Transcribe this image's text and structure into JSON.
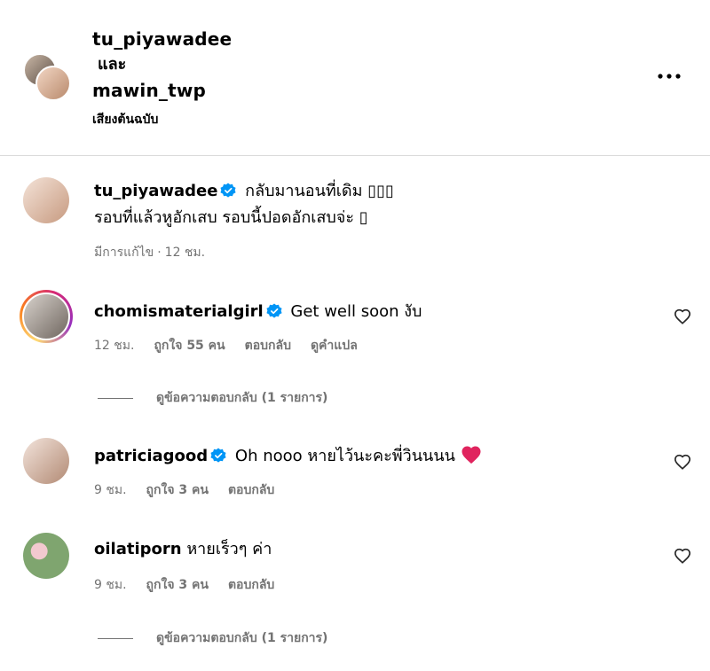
{
  "header": {
    "user1": "tu_piyawadee",
    "and": "และ",
    "user2": "mawin_twp",
    "audio": "เสียงต้นฉบับ"
  },
  "caption": {
    "username": "tu_piyawadee",
    "line1": "กลับมานอนที่เดิม ▯▯▯",
    "line2": "รอบที่แล้วหูอักเสบ รอบนี้ปอดอักเสบจ่ะ ▯",
    "meta_edited": "มีการแก้ไข",
    "meta_dot": "·",
    "meta_time": "12 ชม."
  },
  "comments": [
    {
      "username": "chomismaterialgirl",
      "text": "Get well soon งับ",
      "time": "12 ชม.",
      "likes": "ถูกใจ 55 คน",
      "reply": "ตอบกลับ",
      "translate": "ดูคำแปล",
      "view_replies": "ดูข้อความตอบกลับ (1 รายการ)"
    },
    {
      "username": "patriciagood",
      "text": "Oh nooo หายไว้นะคะพี่วินนนน",
      "time": "9 ชม.",
      "likes": "ถูกใจ 3 คน",
      "reply": "ตอบกลับ"
    },
    {
      "username": "oilatiporn",
      "text": "หายเร็วๆ ค่า",
      "time": "9 ชม.",
      "likes": "ถูกใจ 3 คน",
      "reply": "ตอบกลับ",
      "view_replies": "ดูข้อความตอบกลับ (1 รายการ)"
    }
  ],
  "colors": {
    "verified": "#0095f6",
    "muted": "#737373",
    "heart_red": "#e0245e",
    "divider": "#dbdbdb"
  }
}
